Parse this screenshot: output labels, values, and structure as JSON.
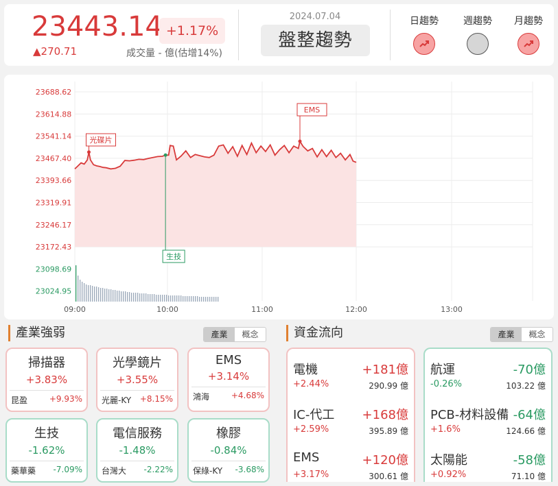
{
  "header": {
    "index_value": "23443.14",
    "change_pct": "+1.17%",
    "change_pts": "▲270.71",
    "volume_text": "成交量 - 億(估增14%)",
    "date": "2024.07.04",
    "trend_label": "盤整趨勢",
    "trends": [
      {
        "label": "日趨勢",
        "state": "up"
      },
      {
        "label": "週趨勢",
        "state": "flat"
      },
      {
        "label": "月趨勢",
        "state": "up"
      }
    ]
  },
  "chart_data": {
    "type": "line",
    "title": "",
    "xlabel": "",
    "ylabel": "",
    "x_ticks": [
      "09:00",
      "10:00",
      "11:00",
      "12:00",
      "13:00"
    ],
    "y_ticks": [
      "23688.62",
      "23614.88",
      "23541.14",
      "23467.40",
      "23393.66",
      "23319.91",
      "23246.17",
      "23172.43",
      "23098.69",
      "23024.95"
    ],
    "ylim": [
      23172.43,
      23688.62
    ],
    "grid": true,
    "colors": {
      "line": "#d83a3a",
      "fill": "#fbe3e3",
      "up_axis": "#d83a3a",
      "down_axis": "#2a9a62"
    },
    "series": [
      {
        "x": [
          "09:00",
          "09:02",
          "09:04",
          "09:06",
          "09:08",
          "09:09",
          "09:10",
          "09:12",
          "09:14",
          "09:16",
          "09:18",
          "09:20",
          "09:23",
          "09:26",
          "09:29",
          "09:32",
          "09:35",
          "09:38",
          "09:41",
          "09:44",
          "09:47",
          "09:50",
          "09:53",
          "09:56",
          "09:58",
          "10:00",
          "10:01",
          "10:03",
          "10:05",
          "10:08",
          "10:11",
          "10:14",
          "10:17",
          "10:20",
          "10:23",
          "10:26",
          "10:29",
          "10:32",
          "10:35",
          "10:38",
          "10:41",
          "10:44",
          "10:47",
          "10:50",
          "10:53",
          "10:56",
          "10:59",
          "11:02",
          "11:05",
          "11:08",
          "11:11",
          "11:14",
          "11:17",
          "11:20",
          "11:23",
          "11:24",
          "11:26",
          "11:29",
          "11:32",
          "11:35",
          "11:38",
          "11:41",
          "11:44",
          "11:47",
          "11:50",
          "11:53",
          "11:56",
          "11:58",
          "12:00"
        ],
        "values": [
          23432,
          23442,
          23452,
          23448,
          23462,
          23488,
          23462,
          23446,
          23442,
          23440,
          23437,
          23436,
          23432,
          23434,
          23441,
          23460,
          23459,
          23461,
          23464,
          23463,
          23467,
          23470,
          23473,
          23474,
          23478,
          23478,
          23510,
          23508,
          23462,
          23475,
          23492,
          23470,
          23480,
          23476,
          23472,
          23470,
          23478,
          23508,
          23512,
          23484,
          23506,
          23474,
          23510,
          23480,
          23518,
          23486,
          23508,
          23490,
          23512,
          23478,
          23496,
          23510,
          23486,
          23508,
          23500,
          23524,
          23507,
          23492,
          23500,
          23472,
          23496,
          23473,
          23494,
          23470,
          23484,
          23462,
          23480,
          23458,
          23454
        ]
      }
    ],
    "volume_bars": [
      53,
      38,
      32,
      29,
      27,
      25,
      24,
      24,
      23,
      22,
      22,
      21,
      20,
      20,
      19,
      19,
      18,
      18,
      17,
      17,
      16,
      16,
      15,
      15,
      15,
      14,
      14,
      13,
      13,
      13,
      13,
      12,
      12,
      12,
      12,
      11,
      11,
      11,
      11,
      10,
      10,
      10,
      10,
      10,
      10,
      9,
      9,
      9,
      9,
      9,
      9,
      9,
      8,
      8,
      8,
      8,
      8,
      8,
      8,
      8,
      7,
      7,
      7,
      7,
      7,
      7,
      7,
      7,
      7,
      7
    ],
    "annotations": [
      {
        "label": "光碟片",
        "time": "09:09",
        "value": 23488,
        "color": "#d83a3a"
      },
      {
        "label": "EMS",
        "time": "11:24",
        "value": 23524,
        "color": "#d83a3a"
      },
      {
        "label": "生技",
        "time": "09:58",
        "value": 23478,
        "color": "#2a9a62"
      }
    ]
  },
  "industry": {
    "title": "產業強弱",
    "toggle": [
      "產業",
      "概念"
    ],
    "cards": [
      {
        "name": "掃描器",
        "pct": "+3.83%",
        "stock": "昆盈",
        "stock_pct": "+9.93%",
        "dir": "up"
      },
      {
        "name": "光學鏡片",
        "pct": "+3.55%",
        "stock": "光麗-KY",
        "stock_pct": "+8.15%",
        "dir": "up"
      },
      {
        "name": "EMS",
        "pct": "+3.14%",
        "stock": "鴻海",
        "stock_pct": "+4.68%",
        "dir": "up"
      },
      {
        "name": "生技",
        "pct": "-1.62%",
        "stock": "藥華藥",
        "stock_pct": "-7.09%",
        "dir": "down"
      },
      {
        "name": "電信服務",
        "pct": "-1.48%",
        "stock": "台灣大",
        "stock_pct": "-2.22%",
        "dir": "down"
      },
      {
        "name": "橡膠",
        "pct": "-0.84%",
        "stock": "保綠-KY",
        "stock_pct": "-3.68%",
        "dir": "down"
      }
    ]
  },
  "fundflow": {
    "title": "資金流向",
    "toggle": [
      "產業",
      "概念"
    ],
    "inflow": [
      {
        "name": "電機",
        "amount": "+181億",
        "pct": "+2.44%",
        "value": "290.99 億"
      },
      {
        "name": "IC-代工",
        "amount": "+168億",
        "pct": "+2.59%",
        "value": "395.89 億"
      },
      {
        "name": "EMS",
        "amount": "+120億",
        "pct": "+3.17%",
        "value": "300.61 億"
      }
    ],
    "outflow": [
      {
        "name": "航運",
        "amount": "-70億",
        "pct": "-0.26%",
        "value": "103.22 億"
      },
      {
        "name": "PCB-材料設備",
        "amount": "-64億",
        "pct": "+1.6%",
        "value": "124.66 億"
      },
      {
        "name": "太陽能",
        "amount": "-58億",
        "pct": "+0.92%",
        "value": "71.10 億"
      }
    ]
  }
}
